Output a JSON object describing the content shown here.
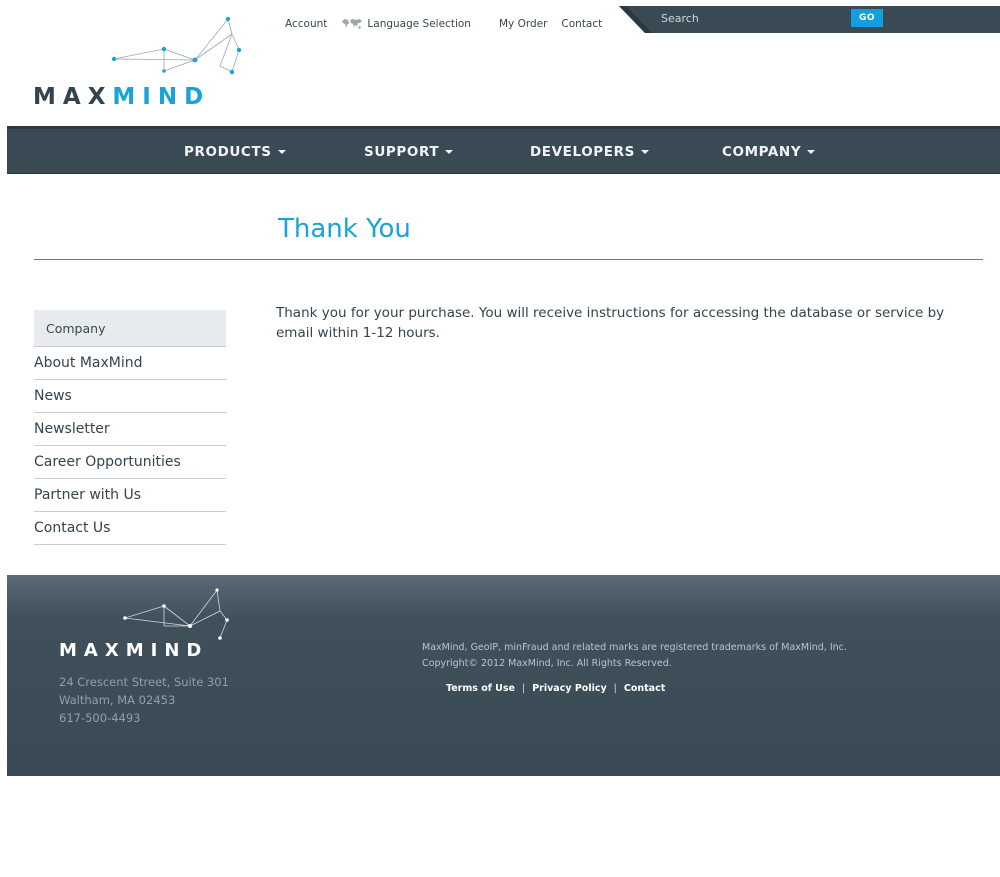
{
  "header": {
    "logo": {
      "text_part1": "MAX",
      "text_part2": "MIND"
    },
    "top_links": {
      "account": "Account",
      "language": "Language Selection",
      "my_order": "My Order",
      "contact": "Contact"
    },
    "search": {
      "placeholder": "Search",
      "go_label": "GO"
    }
  },
  "nav": {
    "items": [
      {
        "label": "PRODUCTS"
      },
      {
        "label": "SUPPORT"
      },
      {
        "label": "DEVELOPERS"
      },
      {
        "label": "COMPANY"
      }
    ]
  },
  "main": {
    "title": "Thank You",
    "body": "Thank you for your purchase. You will receive instructions for accessing the database or service by email within 1-12 hours."
  },
  "sidebar": {
    "heading": "Company",
    "items": [
      {
        "label": "About MaxMind"
      },
      {
        "label": "News"
      },
      {
        "label": "Newsletter"
      },
      {
        "label": "Career Opportunities"
      },
      {
        "label": "Partner with Us"
      },
      {
        "label": "Contact Us"
      }
    ]
  },
  "footer": {
    "logo_text": "MAXMIND",
    "address": {
      "line1": "24 Crescent Street, Suite 301",
      "line2": "Waltham, MA 02453",
      "phone": "617-500-4493"
    },
    "trademark": "MaxMind, GeoIP, minFraud and related marks are registered trademarks of MaxMind, Inc.",
    "copyright": "Copyright© 2012 MaxMind, Inc. All Rights Reserved.",
    "links": {
      "terms": "Terms of Use",
      "privacy": "Privacy Policy",
      "contact": "Contact"
    }
  },
  "colors": {
    "accent": "#1aa3d9",
    "nav_bg": "#394a55",
    "footer_bg": "#3a4a55",
    "text": "#34434e"
  },
  "icons": {
    "language": "globe-map-icon",
    "nav_caret": "caret-down-icon"
  }
}
